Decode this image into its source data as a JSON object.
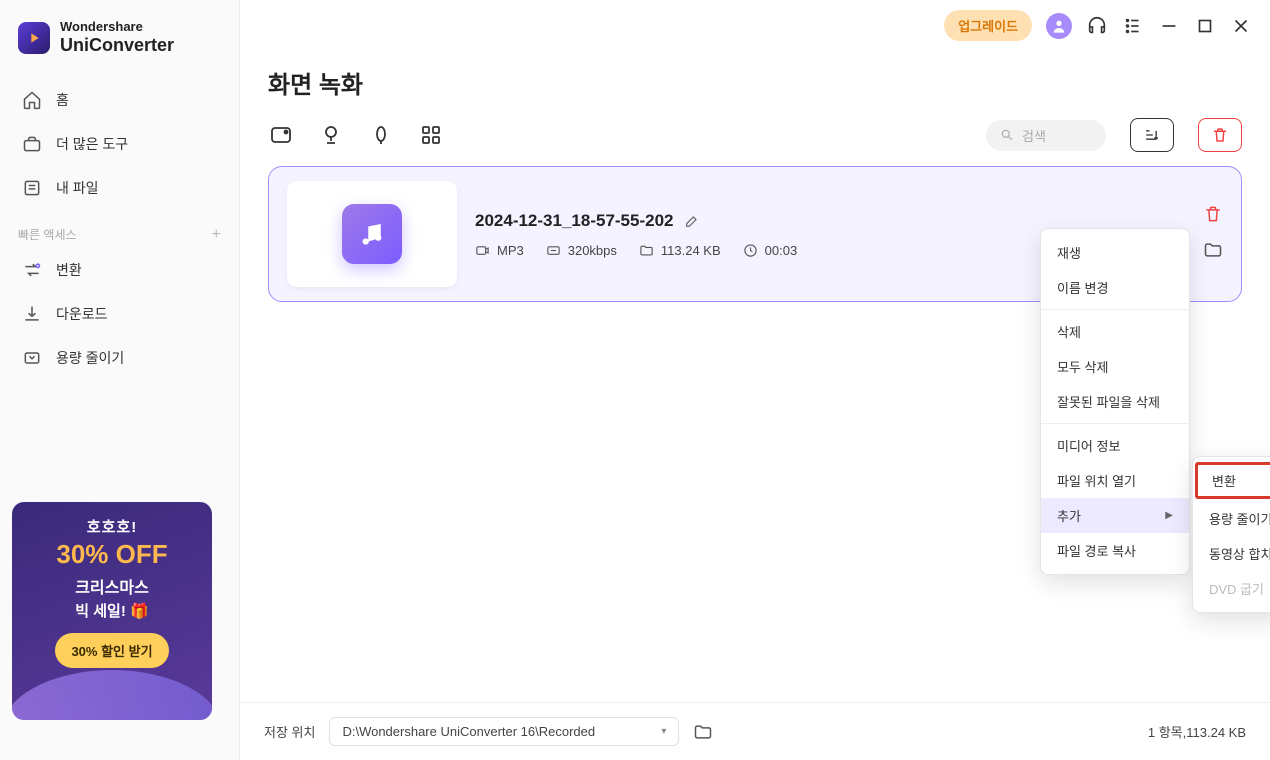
{
  "brand": {
    "line1": "Wondershare",
    "line2": "UniConverter"
  },
  "sidebar": {
    "items": [
      {
        "label": "홈"
      },
      {
        "label": "더 많은 도구"
      },
      {
        "label": "내 파일"
      }
    ],
    "quick_label": "빠른 액세스",
    "quick_items": [
      {
        "label": "변환"
      },
      {
        "label": "다운로드"
      },
      {
        "label": "용량 줄이기"
      }
    ]
  },
  "promo": {
    "line1": "호호호!",
    "line2": "30% OFF",
    "line3": "크리스마스",
    "line4": "빅 세일! 🎁",
    "button": "30% 할인 받기"
  },
  "titlebar": {
    "upgrade": "업그레이드"
  },
  "page_title": "화면 녹화",
  "search": {
    "placeholder": "검색"
  },
  "file": {
    "name": "2024-12-31_18-57-55-202",
    "format": "MP3",
    "bitrate": "320kbps",
    "size": "113.24 KB",
    "duration": "00:03"
  },
  "context_menu": {
    "play": "재생",
    "rename": "이름 변경",
    "delete": "삭제",
    "delete_all": "모두 삭제",
    "delete_bad": "잘못된 파일을 삭제",
    "media_info": "미디어 정보",
    "open_loc": "파일 위치 열기",
    "add": "추가",
    "copy_path": "파일 경로 복사"
  },
  "sub_menu": {
    "convert": "변환",
    "compress": "용량 줄이기",
    "merge": "동영상 합치기",
    "dvd": "DVD 굽기"
  },
  "footer": {
    "save_label": "저장 위치",
    "path": "D:\\Wondershare UniConverter 16\\Recorded",
    "status": "1 항목,113.24 KB"
  }
}
